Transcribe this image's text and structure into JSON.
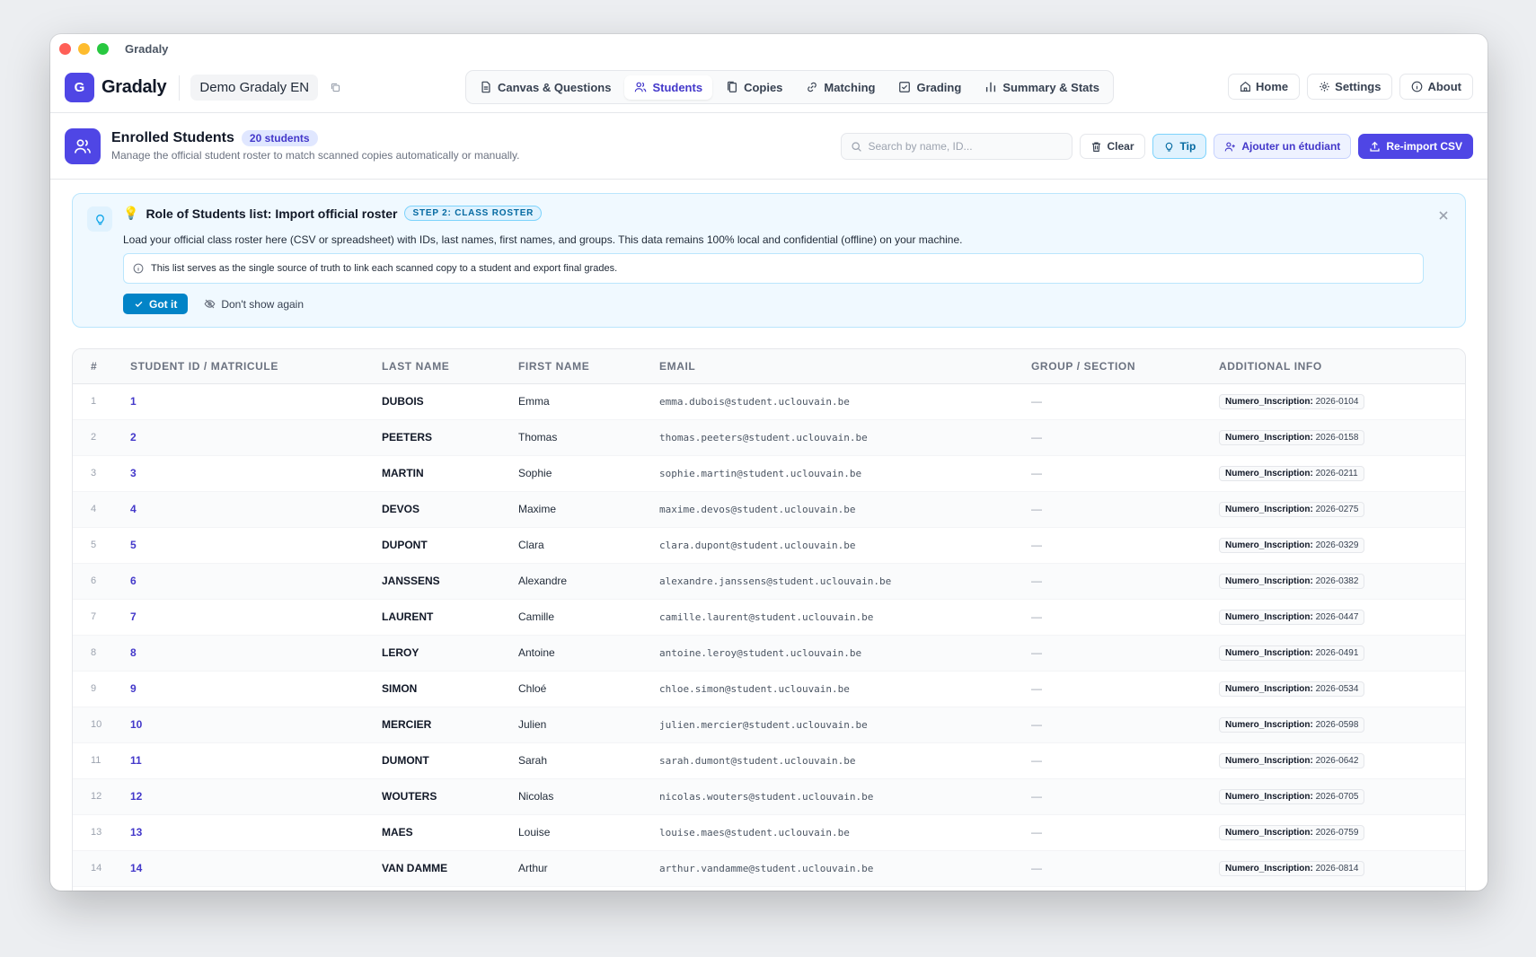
{
  "window": {
    "title": "Gradaly"
  },
  "app": {
    "logo_letter": "G",
    "logo_text": "Gradaly",
    "project_name": "Demo Gradaly EN"
  },
  "nav": {
    "tabs": [
      {
        "label": "Canvas & Questions",
        "icon": "document-icon",
        "active": false
      },
      {
        "label": "Students",
        "icon": "users-icon",
        "active": true
      },
      {
        "label": "Copies",
        "icon": "copies-icon",
        "active": false
      },
      {
        "label": "Matching",
        "icon": "link-icon",
        "active": false
      },
      {
        "label": "Grading",
        "icon": "check-square-icon",
        "active": false
      },
      {
        "label": "Summary & Stats",
        "icon": "bar-chart-icon",
        "active": false
      }
    ],
    "home": "Home",
    "settings": "Settings",
    "about": "About"
  },
  "students_header": {
    "title": "Enrolled Students",
    "count_badge": "20 students",
    "subtitle": "Manage the official student roster to match scanned copies automatically or manually.",
    "search_placeholder": "Search by name, ID...",
    "clear": "Clear",
    "tip": "Tip",
    "add_student": "Ajouter un étudiant",
    "reimport": "Re-import CSV"
  },
  "tip_card": {
    "emoji": "💡",
    "title": "Role of Students list: Import official roster",
    "step_badge": "STEP 2: CLASS ROSTER",
    "body": "Load your official class roster here (CSV or spreadsheet) with IDs, last names, first names, and groups. This data remains 100% local and confidential (offline) on your machine.",
    "note": "This list serves as the single source of truth to link each scanned copy to a student and export final grades.",
    "got_it": "Got it",
    "dont_show": "Don't show again"
  },
  "table": {
    "headers": {
      "num": "#",
      "id": "STUDENT ID / MATRICULE",
      "last": "LAST NAME",
      "first": "FIRST NAME",
      "email": "EMAIL",
      "group": "GROUP / SECTION",
      "info": "ADDITIONAL INFO"
    },
    "info_key": "Numero_Inscription:",
    "rows": [
      {
        "num": "1",
        "id": "1",
        "last": "DUBOIS",
        "first": "Emma",
        "email": "emma.dubois@student.uclouvain.be",
        "group": "—",
        "info": "2026-0104"
      },
      {
        "num": "2",
        "id": "2",
        "last": "PEETERS",
        "first": "Thomas",
        "email": "thomas.peeters@student.uclouvain.be",
        "group": "—",
        "info": "2026-0158"
      },
      {
        "num": "3",
        "id": "3",
        "last": "MARTIN",
        "first": "Sophie",
        "email": "sophie.martin@student.uclouvain.be",
        "group": "—",
        "info": "2026-0211"
      },
      {
        "num": "4",
        "id": "4",
        "last": "DEVOS",
        "first": "Maxime",
        "email": "maxime.devos@student.uclouvain.be",
        "group": "—",
        "info": "2026-0275"
      },
      {
        "num": "5",
        "id": "5",
        "last": "DUPONT",
        "first": "Clara",
        "email": "clara.dupont@student.uclouvain.be",
        "group": "—",
        "info": "2026-0329"
      },
      {
        "num": "6",
        "id": "6",
        "last": "JANSSENS",
        "first": "Alexandre",
        "email": "alexandre.janssens@student.uclouvain.be",
        "group": "—",
        "info": "2026-0382"
      },
      {
        "num": "7",
        "id": "7",
        "last": "LAURENT",
        "first": "Camille",
        "email": "camille.laurent@student.uclouvain.be",
        "group": "—",
        "info": "2026-0447"
      },
      {
        "num": "8",
        "id": "8",
        "last": "LEROY",
        "first": "Antoine",
        "email": "antoine.leroy@student.uclouvain.be",
        "group": "—",
        "info": "2026-0491"
      },
      {
        "num": "9",
        "id": "9",
        "last": "SIMON",
        "first": "Chloé",
        "email": "chloe.simon@student.uclouvain.be",
        "group": "—",
        "info": "2026-0534"
      },
      {
        "num": "10",
        "id": "10",
        "last": "MERCIER",
        "first": "Julien",
        "email": "julien.mercier@student.uclouvain.be",
        "group": "—",
        "info": "2026-0598"
      },
      {
        "num": "11",
        "id": "11",
        "last": "DUMONT",
        "first": "Sarah",
        "email": "sarah.dumont@student.uclouvain.be",
        "group": "—",
        "info": "2026-0642"
      },
      {
        "num": "12",
        "id": "12",
        "last": "WOUTERS",
        "first": "Nicolas",
        "email": "nicolas.wouters@student.uclouvain.be",
        "group": "—",
        "info": "2026-0705"
      },
      {
        "num": "13",
        "id": "13",
        "last": "MAES",
        "first": "Louise",
        "email": "louise.maes@student.uclouvain.be",
        "group": "—",
        "info": "2026-0759"
      },
      {
        "num": "14",
        "id": "14",
        "last": "VAN DAMME",
        "first": "Arthur",
        "email": "arthur.vandamme@student.uclouvain.be",
        "group": "—",
        "info": "2026-0814"
      }
    ]
  }
}
